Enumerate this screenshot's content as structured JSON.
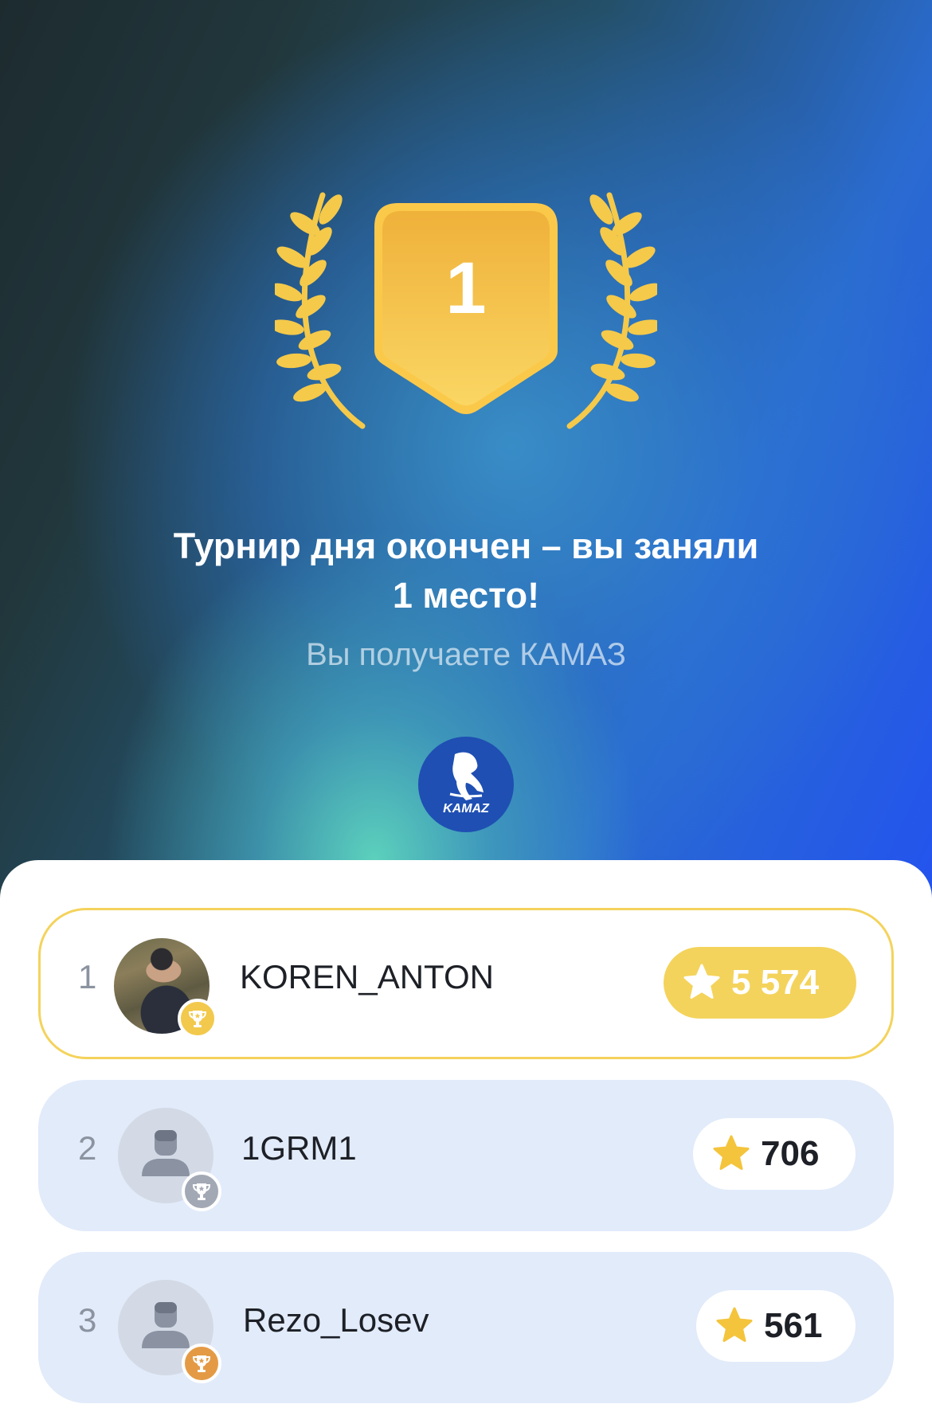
{
  "hero": {
    "place": "1",
    "title_line1": "Турнир дня окончен – вы заняли",
    "title_line2": "1 место!",
    "subtitle": "Вы получаете КАМАЗ",
    "prize_logo_text": "KAMAZ",
    "prize_logo_icon": "kamaz-logo-icon"
  },
  "leaderboard": [
    {
      "rank": "1",
      "name": "KOREN_ANTON",
      "score": "5 574",
      "avatar": "user-photo",
      "badge": "gold-trophy-icon",
      "is_current_user": true
    },
    {
      "rank": "2",
      "name": "1GRM1",
      "score": "706",
      "avatar": "default-user-icon",
      "badge": "silver-trophy-icon",
      "is_current_user": false
    },
    {
      "rank": "3",
      "name": "Rezo_Losev",
      "score": "561",
      "avatar": "default-user-icon",
      "badge": "bronze-trophy-icon",
      "is_current_user": false
    }
  ],
  "colors": {
    "gold": "#f4d35c",
    "row_bg": "#e2ebfa",
    "silver": "#a2a8b4",
    "bronze": "#e49a45",
    "accent_blue": "#2353ee"
  }
}
